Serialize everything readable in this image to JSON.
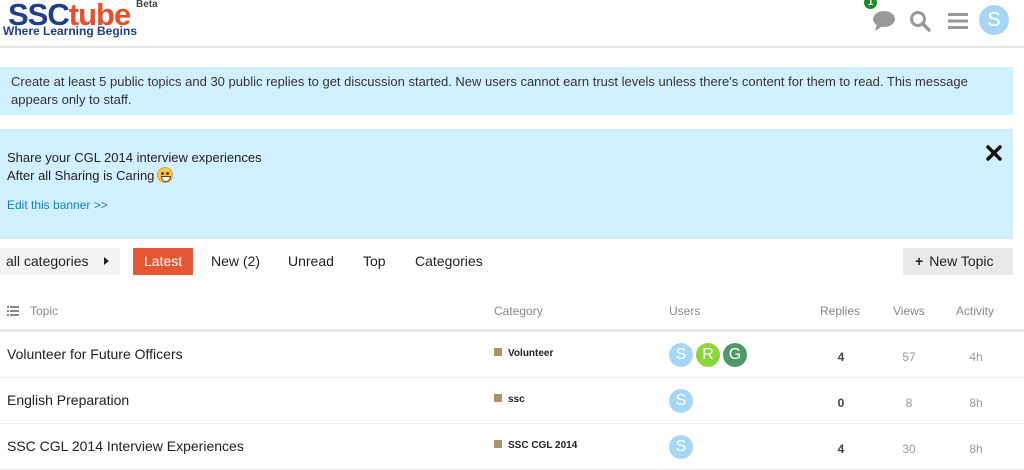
{
  "header": {
    "logo_ssc": "SSC",
    "logo_tube": "tube",
    "logo_beta": "Beta",
    "logo_tagline": "Where Learning Begins",
    "notification_count": "1",
    "user_initial": "S",
    "icons": [
      "chat-bubble-icon",
      "search-icon",
      "hamburger-menu-icon"
    ]
  },
  "staff_notice": {
    "text": "Create at least 5 public topics and 30 public replies to get discussion started. New users cannot earn trust levels unless there's content for them to read. This message appears only to staff."
  },
  "banner": {
    "line1": "Share your CGL 2014 interview experiences",
    "line2": "After all Sharing is Caring",
    "edit_link": "Edit this banner >>"
  },
  "nav": {
    "category_dropdown": "all categories",
    "tabs": [
      "Latest",
      "New (2)",
      "Unread",
      "Top",
      "Categories"
    ],
    "active_tab": "Latest",
    "new_topic_button": "New Topic"
  },
  "table": {
    "headers": {
      "topic": "Topic",
      "category": "Category",
      "users": "Users",
      "replies": "Replies",
      "views": "Views",
      "activity": "Activity"
    },
    "rows": [
      {
        "title": "Volunteer for Future Officers",
        "category": "Volunteer",
        "users": [
          {
            "initial": "S",
            "color": "#a5d7f5"
          },
          {
            "initial": "R",
            "color": "#8bd63c"
          },
          {
            "initial": "G",
            "color": "#4f9966"
          }
        ],
        "replies": "4",
        "views": "57",
        "activity": "4h"
      },
      {
        "title": "English Preparation",
        "category": "ssc",
        "users": [
          {
            "initial": "S",
            "color": "#a5d7f5"
          }
        ],
        "replies": "0",
        "views": "8",
        "activity": "8h"
      },
      {
        "title": "SSC CGL 2014 Interview Experiences",
        "category": "SSC CGL 2014",
        "users": [
          {
            "initial": "S",
            "color": "#a5d7f5"
          }
        ],
        "replies": "4",
        "views": "30",
        "activity": "8h"
      }
    ]
  },
  "colors": {
    "accent": "#e45735",
    "notice_bg": "#d1f0ff",
    "link": "#0f7fc4",
    "category_badge": "#aa956a"
  }
}
